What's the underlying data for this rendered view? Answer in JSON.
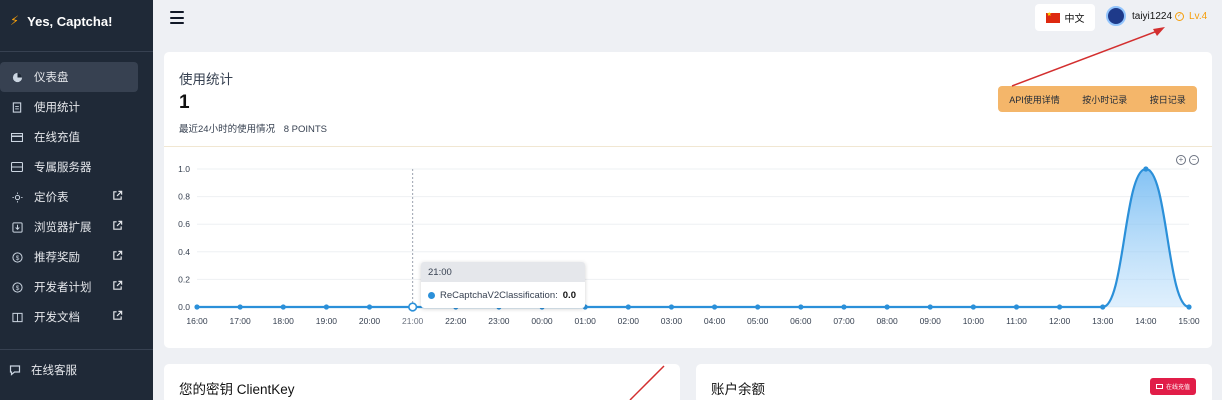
{
  "app": {
    "title": "Yes, Captcha!"
  },
  "sidebar": {
    "items": [
      {
        "label": "仪表盘",
        "icon": "pie-chart-icon",
        "external": false,
        "active": true
      },
      {
        "label": "使用统计",
        "icon": "document-icon",
        "external": false,
        "active": false
      },
      {
        "label": "在线充值",
        "icon": "credit-card-icon",
        "external": false,
        "active": false
      },
      {
        "label": "专属服务器",
        "icon": "server-icon",
        "external": false,
        "active": false
      },
      {
        "label": "定价表",
        "icon": "sun-icon",
        "external": true,
        "active": false
      },
      {
        "label": "浏览器扩展",
        "icon": "download-icon",
        "external": true,
        "active": false
      },
      {
        "label": "推荐奖励",
        "icon": "dollar-icon",
        "external": true,
        "active": false
      },
      {
        "label": "开发者计划",
        "icon": "dollar-icon",
        "external": true,
        "active": false
      },
      {
        "label": "开发文档",
        "icon": "book-icon",
        "external": true,
        "active": false
      }
    ],
    "service_label": "在线客服"
  },
  "header": {
    "language": "中文",
    "username": "taiyi1224",
    "level": "Lv.4"
  },
  "stats": {
    "title": "使用统计",
    "value": "1",
    "subtitle": "最近24小时的使用情况",
    "points": "8 POINTS",
    "buttons": [
      "API使用详情",
      "按小时记录",
      "按日记录"
    ]
  },
  "tooltip": {
    "time": "21:00",
    "series": "ReCaptchaV2Classification:",
    "value": "0.0"
  },
  "clientkey": {
    "title": "您的密钥 ClientKey"
  },
  "balance": {
    "title": "账户余额",
    "badge": "在线充值"
  },
  "chart_data": {
    "type": "area",
    "x": [
      "16:00",
      "17:00",
      "18:00",
      "19:00",
      "20:00",
      "21:00",
      "22:00",
      "23:00",
      "00:00",
      "01:00",
      "02:00",
      "03:00",
      "04:00",
      "05:00",
      "06:00",
      "07:00",
      "08:00",
      "09:00",
      "10:00",
      "11:00",
      "12:00",
      "13:00",
      "14:00",
      "15:00"
    ],
    "series": [
      {
        "name": "ReCaptchaV2Classification",
        "values": [
          0,
          0,
          0,
          0,
          0,
          0,
          0,
          0,
          0,
          0,
          0,
          0,
          0,
          0,
          0,
          0,
          0,
          0,
          0,
          0,
          0,
          0,
          1,
          0
        ]
      }
    ],
    "yticks": [
      "0.0",
      "0.2",
      "0.4",
      "0.6",
      "0.8",
      "1.0"
    ],
    "ylim": [
      0,
      1
    ],
    "grid": true,
    "color": "#2b90d9"
  }
}
